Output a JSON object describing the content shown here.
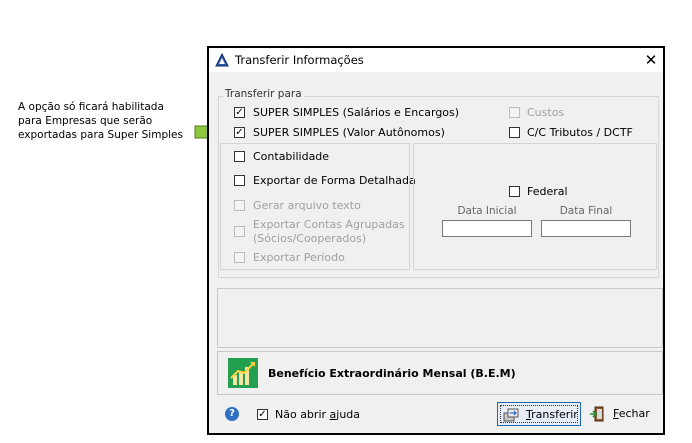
{
  "annotation": {
    "line1": "A opção só ficará habilitada",
    "line2": "para Empresas que serão",
    "line3": "exportadas para Super Simples"
  },
  "window": {
    "title": "Transferir Informações",
    "close_glyph": "✕"
  },
  "transferir_para": {
    "legend": "Transferir para",
    "super_simples_salarios": {
      "label": "SUPER SIMPLES (Salários e Encargos)",
      "checked": true
    },
    "super_simples_valor": {
      "label": "SUPER SIMPLES (Valor Autônomos)",
      "checked": true
    },
    "custos": {
      "label": "Custos",
      "checked": false,
      "disabled": true
    },
    "cc_tributos": {
      "label": "C/C Tributos / DCTF",
      "checked": false
    },
    "contabilidade": {
      "label": "Contabilidade",
      "checked": false
    },
    "exportar_detalhada": {
      "label": "Exportar de Forma Detalhada",
      "checked": false
    },
    "gerar_texto": {
      "label": "Gerar arquivo texto",
      "disabled": true
    },
    "exportar_contas_1": "Exportar Contas Agrupadas",
    "exportar_contas_2": "(Sócios/Cooperados)",
    "exportar_periodo": {
      "label": "Exportar Período",
      "disabled": true
    },
    "federal": {
      "label": "Federal",
      "checked": false
    },
    "data_inicial_label": "Data Inicial",
    "data_final_label": "Data Final",
    "data_inicial_value": "",
    "data_final_value": ""
  },
  "bem": {
    "label": "Benefício Extraordinário Mensal (B.E.M)"
  },
  "footer": {
    "nao_abrir_prefix": "Não abrir ",
    "nao_abrir_key": "a",
    "nao_abrir_suffix": "juda",
    "nao_abrir_checked": true,
    "transferir_key": "T",
    "transferir_rest": "ransferir",
    "fechar_key": "F",
    "fechar_rest": "echar",
    "help_glyph": "?"
  },
  "colors": {
    "arrow_green": "#8dc63f",
    "bem_green": "#22a050",
    "focus_blue": "#1e68b8"
  }
}
